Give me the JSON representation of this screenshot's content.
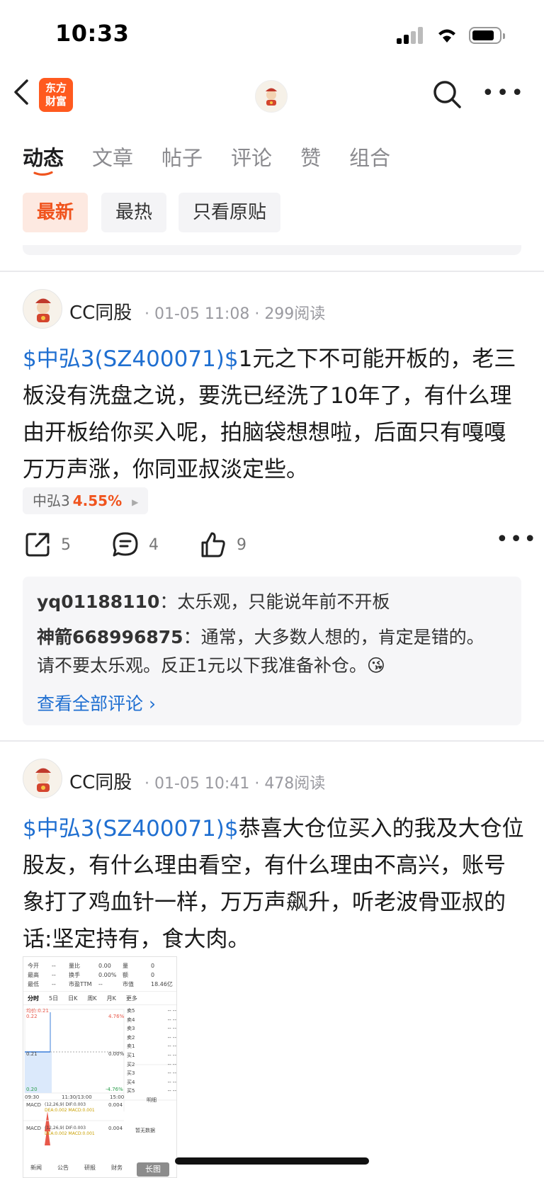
{
  "status_bar": {
    "time": "10:33"
  },
  "nav": {
    "logo_text": "东方\n财富",
    "logo_line1": "东方",
    "logo_line2": "财富"
  },
  "tabs": [
    "动态",
    "文章",
    "帖子",
    "评论",
    "赞",
    "组合"
  ],
  "filters": [
    "最新",
    "最热",
    "只看原贴"
  ],
  "colors": {
    "accent": "#f0541e",
    "link": "#1f6fd1"
  },
  "posts": [
    {
      "author": "CC同股",
      "date": "01-05 11:08",
      "reads": "299阅读",
      "tag": "$中弘3(SZ400071)$",
      "text": "1元之下不可能开板的，老三板没有洗盘之说，要洗已经洗了10年了，有什么理由开板给你买入呢，拍脑袋想想啦，后面只有嘎嘎万万声涨，你同亚叔淡定些。",
      "stock": {
        "name": "中弘3",
        "change": "4.55%"
      },
      "shares": "5",
      "comments_count": "4",
      "likes": "9",
      "comments": [
        {
          "user": "yq01188110",
          "text": "太乐观，只能说年前不开板"
        },
        {
          "user": "神箭668996875",
          "text": "通常，大多数人想的，肯定是错的。请不要太乐观。反正1元以下我准备补仓。😘"
        }
      ],
      "view_all": "查看全部评论"
    },
    {
      "author": "CC同股",
      "date": "01-05 10:41",
      "reads": "478阅读",
      "tag": "$中弘3(SZ400071)$",
      "text": "恭喜大仓位买入的我及大仓位股友，有什么理由看空，有什么理由不高兴，账号象打了鸡血针一样，万万声飙升，听老波骨亚叔的话:坚定持有，食大肉。",
      "image": {
        "rows": [
          [
            "今开",
            "--",
            "量比",
            "0.00",
            "量",
            "0"
          ],
          [
            "最高",
            "--",
            "换手",
            "0.00%",
            "额",
            "0"
          ],
          [
            "最低",
            "--",
            "市盈TTM",
            "--",
            "市值",
            "18.46亿"
          ]
        ],
        "tabs": [
          "分时",
          "5日",
          "日K",
          "周K",
          "月K",
          "更多"
        ],
        "prices": [
          "0.22",
          "0.21",
          "0.20"
        ],
        "pct_labels": [
          "4.76%",
          "0.00%",
          "-4.76%"
        ],
        "sell_labels": [
          "卖5",
          "卖4",
          "卖3",
          "卖2",
          "卖1"
        ],
        "buy_labels": [
          "买1",
          "买2",
          "买3",
          "买4",
          "买5"
        ],
        "times": [
          "09:30",
          "11:30/13:00",
          "15:00"
        ],
        "detail_label": "明细",
        "no_data": "暂无数据",
        "macd": "MACD",
        "macd_params": "(12,26,9) DIF:0.003",
        "dea": "DEA:0.002 MACD:0.001",
        "bottom_tabs": [
          "新闻",
          "公告",
          "研报",
          "财务"
        ],
        "long_label": "长图",
        "price_top": "均价:0.21",
        "macd_val": "0.004"
      }
    }
  ]
}
